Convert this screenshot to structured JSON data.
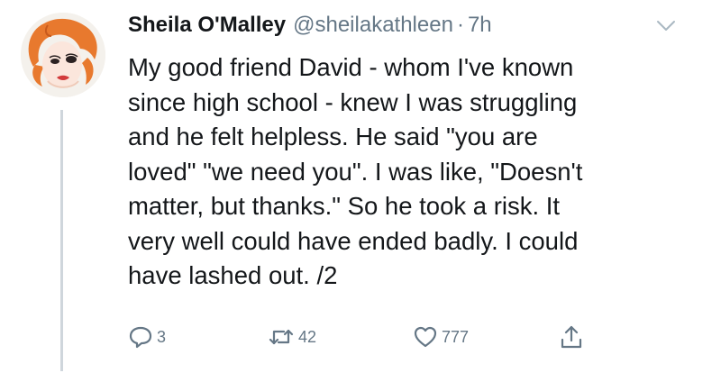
{
  "tweet": {
    "author_name": "Sheila O'Malley",
    "handle": "@sheilakathleen",
    "separator": "·",
    "time": "7h",
    "lines": [
      "My good friend David - whom I've known",
      "since high school - knew I was struggling",
      "and he felt helpless. He said \"you are",
      "loved\" \"we need you\". I was like, \"Doesn't",
      "matter, but thanks.\" So he took a risk. It",
      "very well could have ended badly. I could",
      "have lashed out. /2"
    ],
    "actions": {
      "reply_count": "3",
      "retweet_count": "42",
      "like_count": "777"
    }
  },
  "icons": {
    "menu": "chevron-down-icon",
    "reply": "reply-icon",
    "retweet": "retweet-icon",
    "like": "heart-icon",
    "share": "share-icon"
  },
  "colors": {
    "text": "#14171a",
    "muted": "#657786",
    "thread_line": "#cfd6dc",
    "hair": "#e8792e"
  }
}
